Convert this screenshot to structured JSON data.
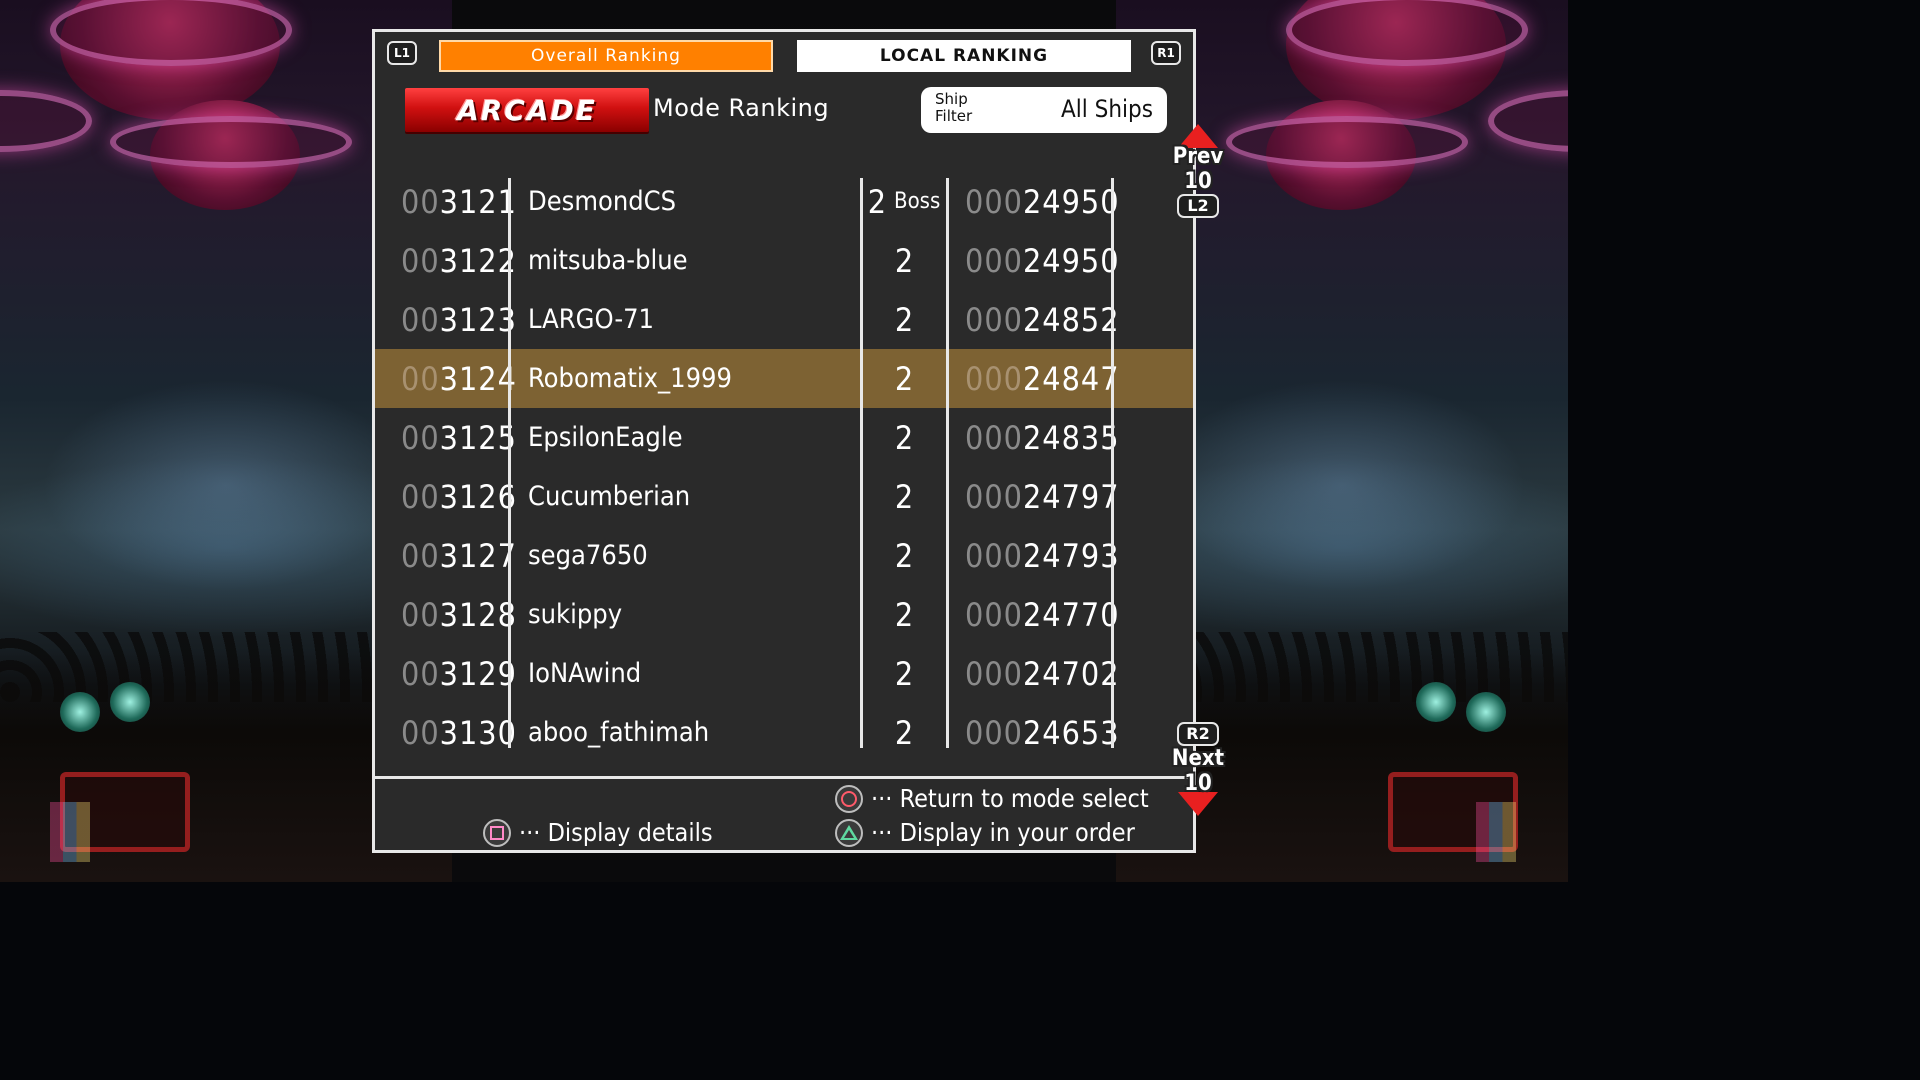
{
  "tabs": {
    "l1_label": "L1",
    "r1_label": "R1",
    "overall_label": "Overall Ranking",
    "local_label": "LOCAL RANKING"
  },
  "mode": {
    "badge": "ARCADE",
    "title": "Mode Ranking"
  },
  "filter": {
    "label": "Ship Filter",
    "value": "All Ships"
  },
  "rankings": [
    {
      "rank_prefix": "00",
      "rank": "3121",
      "name": "DesmondCS",
      "stage": "2",
      "stage_suffix": "Boss",
      "score_prefix": "000",
      "score": "24950"
    },
    {
      "rank_prefix": "00",
      "rank": "3122",
      "name": "mitsuba-blue",
      "stage": "2",
      "stage_suffix": "",
      "score_prefix": "000",
      "score": "24950"
    },
    {
      "rank_prefix": "00",
      "rank": "3123",
      "name": "LARGO-71",
      "stage": "2",
      "stage_suffix": "",
      "score_prefix": "000",
      "score": "24852"
    },
    {
      "rank_prefix": "00",
      "rank": "3124",
      "name": "Robomatix_1999",
      "stage": "2",
      "stage_suffix": "",
      "score_prefix": "000",
      "score": "24847"
    },
    {
      "rank_prefix": "00",
      "rank": "3125",
      "name": "EpsilonEagle",
      "stage": "2",
      "stage_suffix": "",
      "score_prefix": "000",
      "score": "24835"
    },
    {
      "rank_prefix": "00",
      "rank": "3126",
      "name": "Cucumberian",
      "stage": "2",
      "stage_suffix": "",
      "score_prefix": "000",
      "score": "24797"
    },
    {
      "rank_prefix": "00",
      "rank": "3127",
      "name": "sega7650",
      "stage": "2",
      "stage_suffix": "",
      "score_prefix": "000",
      "score": "24793"
    },
    {
      "rank_prefix": "00",
      "rank": "3128",
      "name": "sukippy",
      "stage": "2",
      "stage_suffix": "",
      "score_prefix": "000",
      "score": "24770"
    },
    {
      "rank_prefix": "00",
      "rank": "3129",
      "name": "IoNAwind",
      "stage": "2",
      "stage_suffix": "",
      "score_prefix": "000",
      "score": "24702"
    },
    {
      "rank_prefix": "00",
      "rank": "3130",
      "name": "aboo_fathimah",
      "stage": "2",
      "stage_suffix": "",
      "score_prefix": "000",
      "score": "24653"
    }
  ],
  "highlighted_row": 3,
  "nav": {
    "prev_label": "Prev 10",
    "prev_button": "L2",
    "next_label": "Next 10",
    "next_button": "R2"
  },
  "hints": {
    "return": "··· Return to mode select",
    "details": "··· Display details",
    "your_order": "··· Display in your order"
  },
  "colors": {
    "tab_active": "#ff8000",
    "highlight_row": "#7d6233",
    "panel_bg": "#2a2a2a",
    "arrow": "#e82020"
  },
  "icons": {
    "return": "circle-button-icon",
    "details": "square-button-icon",
    "your_order": "triangle-button-icon"
  }
}
